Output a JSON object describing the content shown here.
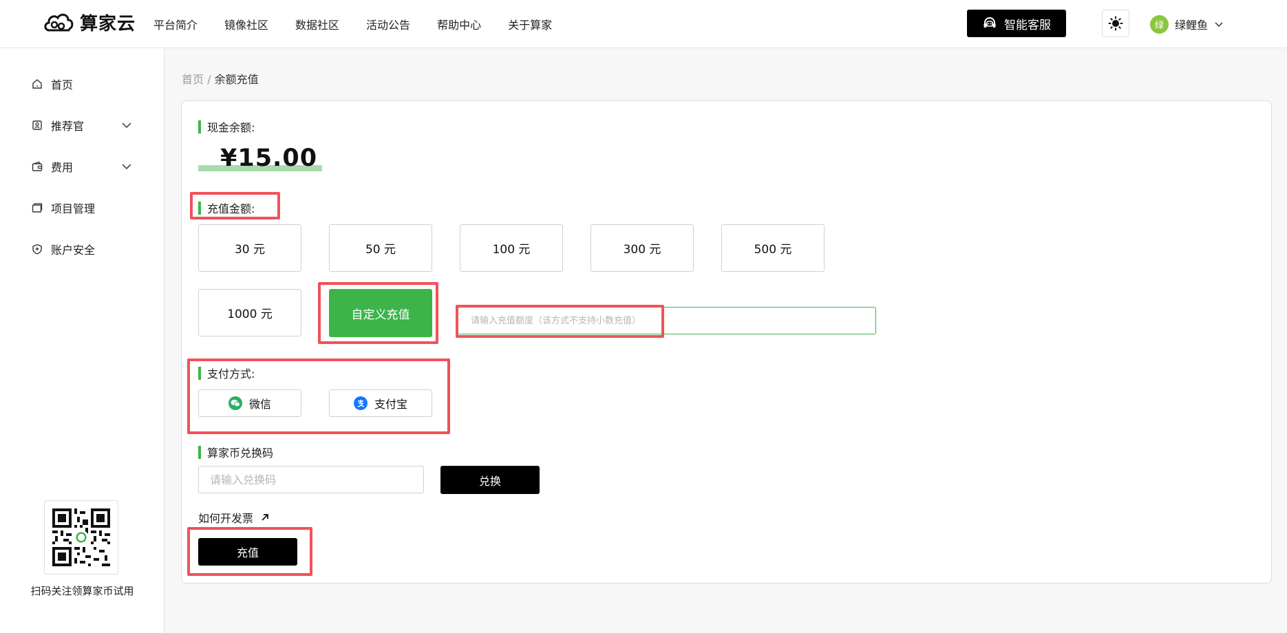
{
  "header": {
    "logo_text": "算家云",
    "nav": [
      "平台简介",
      "镜像社区",
      "数据社区",
      "活动公告",
      "帮助中心",
      "关于算家"
    ],
    "service_label": "智能客服",
    "user_avatar_char": "绿",
    "user_name": "绿鲤鱼"
  },
  "sidebar": {
    "items": [
      {
        "label": "首页",
        "icon": "home-icon"
      },
      {
        "label": "推荐官",
        "icon": "badge-icon",
        "expandable": true
      },
      {
        "label": "费用",
        "icon": "wallet-icon",
        "expandable": true
      },
      {
        "label": "项目管理",
        "icon": "folder-icon"
      },
      {
        "label": "账户安全",
        "icon": "shield-icon"
      }
    ],
    "qr_caption": "扫码关注领算家币试用"
  },
  "breadcrumb": {
    "home": "首页",
    "separator": " / ",
    "current": "余额充值"
  },
  "balance": {
    "label": "现金余额:",
    "value": "¥15.00"
  },
  "recharge": {
    "label": "充值金额:",
    "amounts": [
      "30 元",
      "50 元",
      "100 元",
      "300 元",
      "500 元",
      "1000 元"
    ],
    "custom_label": "自定义充值",
    "custom_placeholder": "请输入充值额度（该方式不支持小数充值）"
  },
  "payment": {
    "label": "支付方式:",
    "methods": [
      {
        "label": "微信",
        "icon": "wechat-icon",
        "color": "#2aae67"
      },
      {
        "label": "支付宝",
        "icon": "alipay-icon",
        "color": "#1677ff"
      }
    ]
  },
  "redeem": {
    "label": "算家币兑换码",
    "placeholder": "请输入兑换码",
    "button": "兑换"
  },
  "invoice_link": "如何开发票",
  "submit_label": "充值",
  "colors": {
    "accent": "#3cb44a",
    "annotation": "#f0525a",
    "primary_dark": "#000000"
  }
}
